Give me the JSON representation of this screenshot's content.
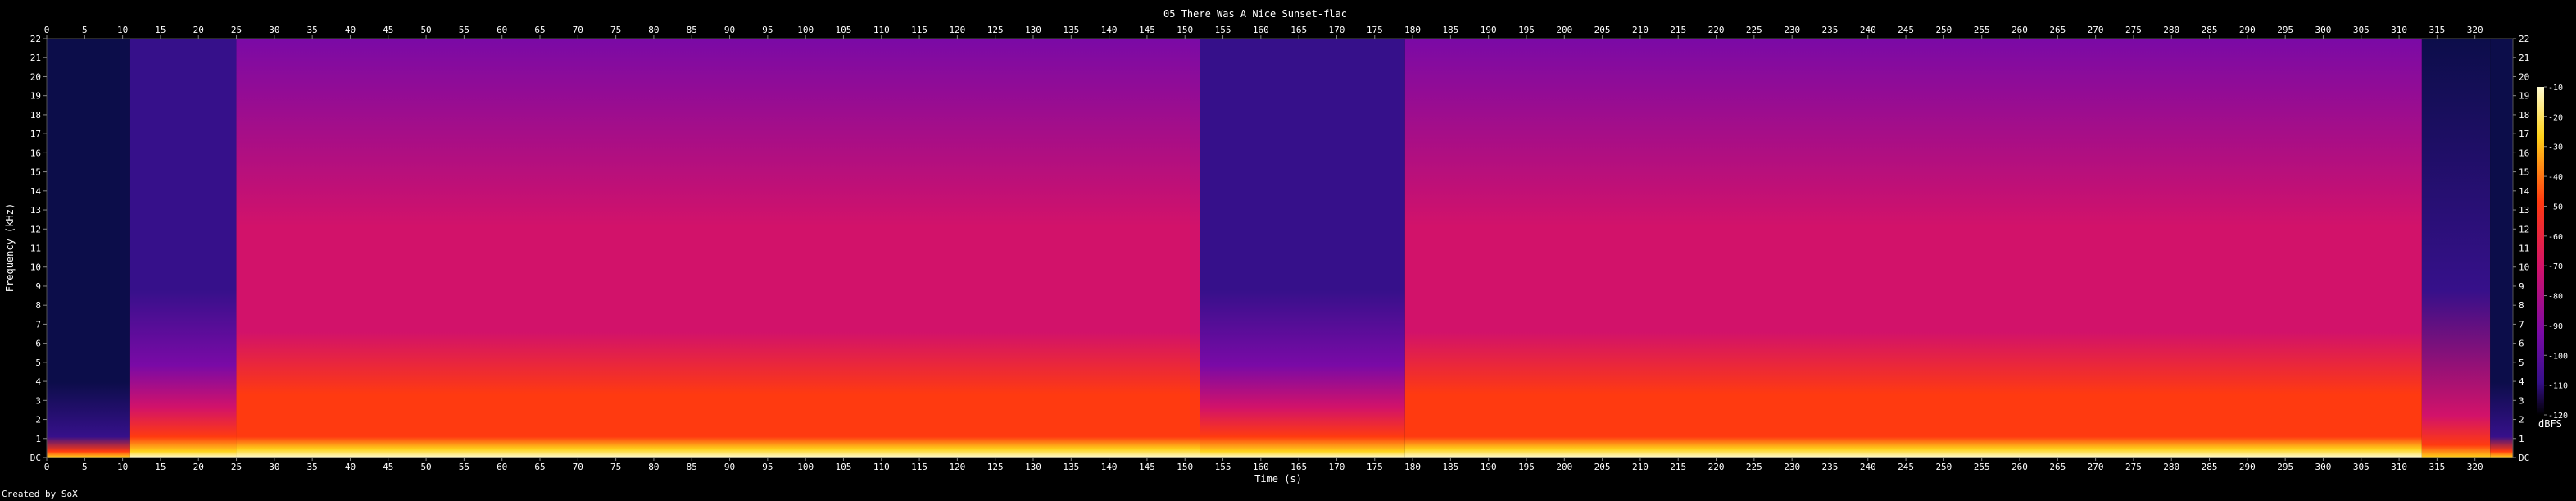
{
  "chart_data": {
    "type": "heatmap",
    "title": "05 There Was A Nice Sunset-flac",
    "xlabel": "Time (s)",
    "ylabel": "Frequency (kHz)",
    "xlim": [
      0,
      325
    ],
    "ylim": [
      0,
      22
    ],
    "x_ticks": [
      "0",
      "5",
      "10",
      "15",
      "20",
      "25",
      "30",
      "35",
      "40",
      "45",
      "50",
      "55",
      "60",
      "65",
      "70",
      "75",
      "80",
      "85",
      "90",
      "95",
      "100",
      "105",
      "110",
      "115",
      "120",
      "125",
      "130",
      "135",
      "140",
      "145",
      "150",
      "155",
      "160",
      "165",
      "170",
      "175",
      "180",
      "185",
      "190",
      "195",
      "200",
      "205",
      "210",
      "215",
      "220",
      "225",
      "230",
      "235",
      "240",
      "245",
      "250",
      "255",
      "260",
      "265",
      "270",
      "275",
      "280",
      "285",
      "290",
      "295",
      "300",
      "305",
      "310",
      "315",
      "320"
    ],
    "y_ticks": [
      "DC",
      "1",
      "2",
      "3",
      "4",
      "5",
      "6",
      "7",
      "8",
      "9",
      "10",
      "11",
      "12",
      "13",
      "14",
      "15",
      "16",
      "17",
      "18",
      "19",
      "20",
      "21",
      "22"
    ],
    "colorbar": {
      "label": "dBFS",
      "range": [
        -120,
        -10
      ],
      "ticks": [
        "-10",
        "-20",
        "-30",
        "-40",
        "-50",
        "-60",
        "-70",
        "-80",
        "-90",
        "-100",
        "-110",
        "-120"
      ]
    },
    "segments": [
      {
        "start": 0,
        "end": 11,
        "level": "quiet",
        "top_khz": 22
      },
      {
        "start": 11,
        "end": 25,
        "level": "medium",
        "top_khz": 22
      },
      {
        "start": 25,
        "end": 152,
        "level": "loud",
        "top_khz": 22
      },
      {
        "start": 152,
        "end": 179,
        "level": "medium",
        "top_khz": 22
      },
      {
        "start": 179,
        "end": 313,
        "level": "loud",
        "top_khz": 22
      },
      {
        "start": 313,
        "end": 322,
        "level": "fade",
        "top_khz": 22
      },
      {
        "start": 322,
        "end": 325,
        "level": "quiet",
        "top_khz": 22
      }
    ],
    "colors": {
      "background": "#000000",
      "quiet": "#0c0d4a",
      "medium": "#36108a",
      "loud_high": "#7a0aa6",
      "loud_mid": "#d2126a",
      "loud_low": "#ff3a10",
      "bass": "#ffd21a",
      "peak": "#fffbd0"
    },
    "footer": "Created by SoX"
  }
}
